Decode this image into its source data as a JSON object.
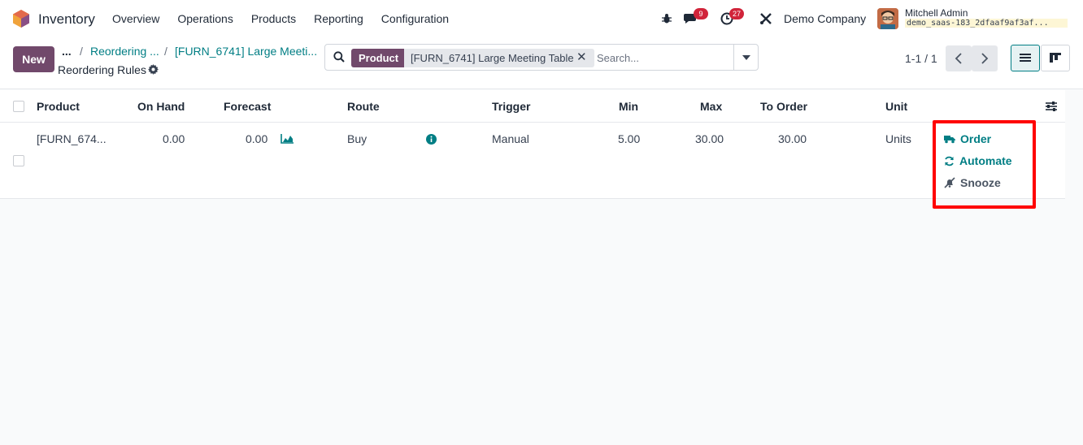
{
  "navbar": {
    "app_name": "Inventory",
    "menu": [
      "Overview",
      "Operations",
      "Products",
      "Reporting",
      "Configuration"
    ],
    "messages_count": "9",
    "activities_count": "27",
    "company": "Demo Company",
    "user_name": "Mitchell Admin",
    "db_name": "demo_saas-183_2dfaaf9af3af..."
  },
  "control": {
    "new_label": "New",
    "breadcrumb_dots": "...",
    "breadcrumb_1": "Reordering ...",
    "breadcrumb_2": "[FURN_6741] Large Meeti...",
    "title": "Reordering Rules",
    "facet_label": "Product",
    "facet_value": "[FURN_6741] Large Meeting Table",
    "search_placeholder": "Search...",
    "pager": "1-1 / 1"
  },
  "table": {
    "headers": [
      "Product",
      "On Hand",
      "Forecast",
      "Route",
      "Trigger",
      "Min",
      "Max",
      "To Order",
      "Unit"
    ],
    "row": {
      "product": "[FURN_674...",
      "on_hand": "0.00",
      "forecast": "0.00",
      "route": "Buy",
      "trigger": "Manual",
      "min": "5.00",
      "max": "30.00",
      "to_order": "30.00",
      "unit": "Units"
    },
    "actions": {
      "order": "Order",
      "automate": "Automate",
      "snooze": "Snooze"
    }
  },
  "colors": {
    "brand": "#71496b",
    "link": "#017e84",
    "badge": "#d1243a",
    "highlight": "#ff0000"
  },
  "icons": [
    "app-logo-icon",
    "bug-icon",
    "chat-icon",
    "clock-icon",
    "tools-icon",
    "search-icon",
    "gear-icon",
    "graph-icon",
    "info-icon",
    "truck-icon",
    "refresh-icon",
    "bell-slash-icon",
    "list-view-icon",
    "kanban-view-icon",
    "optional-columns-icon"
  ]
}
